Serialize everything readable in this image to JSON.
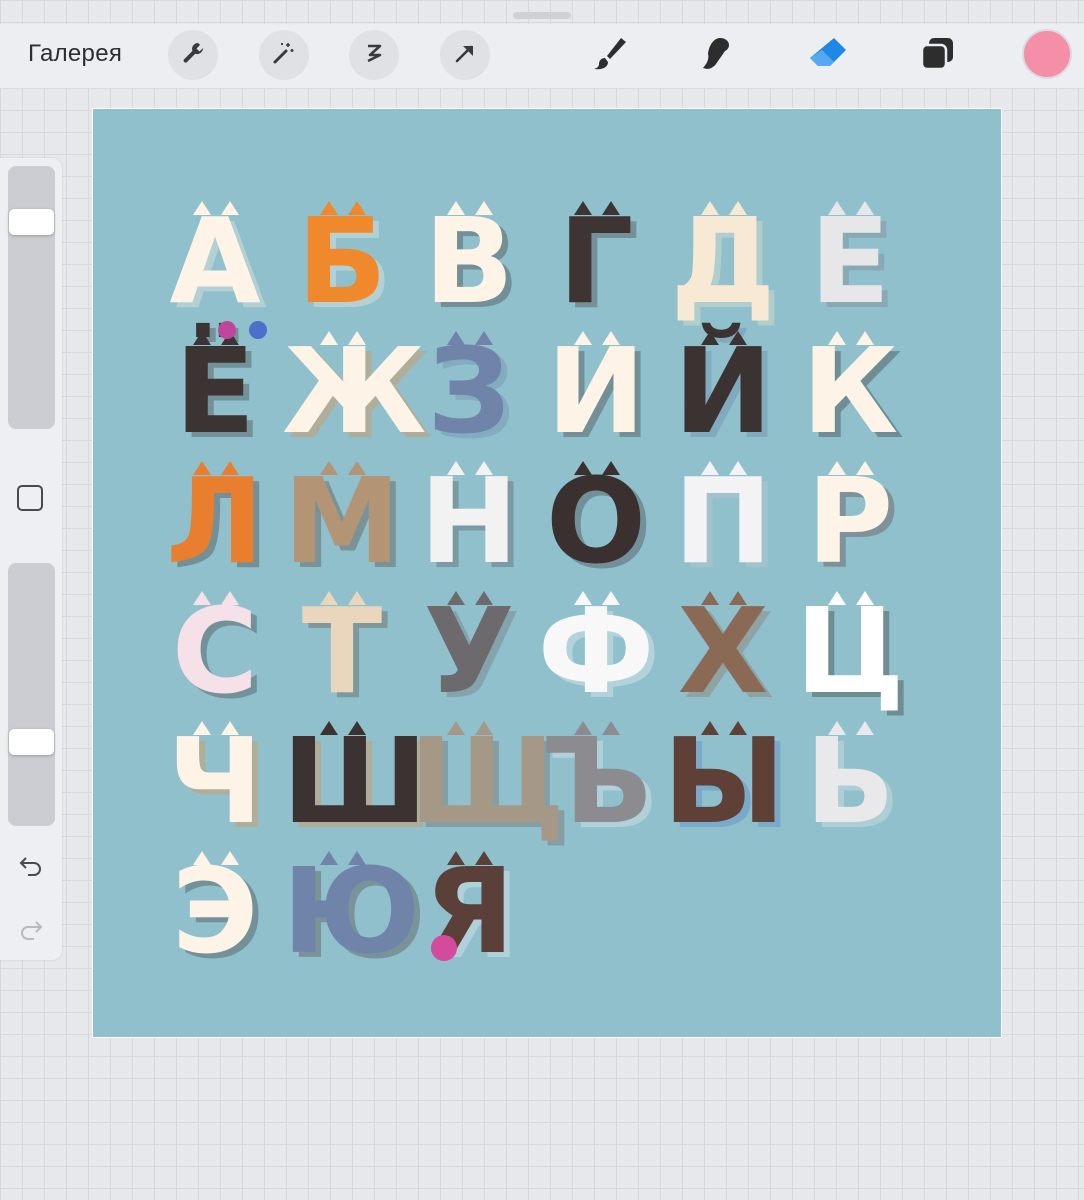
{
  "toolbar": {
    "gallery_label": "Галерея",
    "actions": [
      "wrench-icon",
      "magic-wand-icon",
      "selection-icon",
      "transform-arrow-icon"
    ],
    "tools": [
      "brush-icon",
      "smudge-icon",
      "eraser-icon",
      "layers-icon"
    ],
    "active_tool": "eraser",
    "current_color": "#f48fa7"
  },
  "sidebar": {
    "brush_size_level": 0.82,
    "opacity_level": 0.3,
    "controls": [
      "modify-button",
      "undo-icon",
      "redo-icon"
    ]
  },
  "canvas": {
    "background": "#8fc0cc",
    "letters": [
      {
        "char": "А",
        "colors": [
          "#fdf3e6",
          "#fdf3e6"
        ]
      },
      {
        "char": "Б",
        "colors": [
          "#f0892b",
          "#fdf3e6"
        ]
      },
      {
        "char": "В",
        "colors": [
          "#fdf3e6",
          "#3b2f2f"
        ]
      },
      {
        "char": "Г",
        "colors": [
          "#3e3434",
          "#3e3434"
        ]
      },
      {
        "char": "Д",
        "colors": [
          "#f7e9d4",
          "#f7e9d4"
        ]
      },
      {
        "char": "Е",
        "colors": [
          "#e7e7ea",
          "#7f7f85"
        ]
      },
      {
        "char": "Ё",
        "colors": [
          "#3c3333",
          "#3c3333"
        ]
      },
      {
        "char": "Ж",
        "colors": [
          "#fdf3e6",
          "#ec8a3a"
        ]
      },
      {
        "char": "З",
        "colors": [
          "#6f84a8",
          "#6f84a8"
        ]
      },
      {
        "char": "И",
        "colors": [
          "#fdf3e6",
          "#3b2f2f"
        ]
      },
      {
        "char": "Й",
        "colors": [
          "#3b3232",
          "#6a7fa2"
        ]
      },
      {
        "char": "К",
        "colors": [
          "#fdf3e6",
          "#2f2828"
        ]
      },
      {
        "char": "Л",
        "colors": [
          "#e97f2e",
          "#3b2f2f"
        ]
      },
      {
        "char": "М",
        "colors": [
          "#b39475",
          "#4e3b2f"
        ]
      },
      {
        "char": "Н",
        "colors": [
          "#f2f2f2",
          "#505050"
        ]
      },
      {
        "char": "О",
        "colors": [
          "#3a3030",
          "#3a3030"
        ]
      },
      {
        "char": "П",
        "colors": [
          "#f3f3f5",
          "#c8c8cc"
        ]
      },
      {
        "char": "Р",
        "colors": [
          "#fdf3e6",
          "#5b3a34"
        ]
      },
      {
        "char": "С",
        "colors": [
          "#f6e1e8",
          "#3b3232"
        ]
      },
      {
        "char": "Т",
        "colors": [
          "#e9d6bc",
          "#5a4a3c"
        ]
      },
      {
        "char": "У",
        "colors": [
          "#6d6a6e",
          "#6d6a6e"
        ]
      },
      {
        "char": "Ф",
        "colors": [
          "#f8f8f8",
          "#f8f8f8"
        ]
      },
      {
        "char": "Х",
        "colors": [
          "#8a6a55",
          "#8a6a55"
        ]
      },
      {
        "char": "Ц",
        "colors": [
          "#ffffff",
          "#2f2828"
        ]
      },
      {
        "char": "Ч",
        "colors": [
          "#fdf3e6",
          "#ef8a30"
        ]
      },
      {
        "char": "Ш",
        "colors": [
          "#3d3232",
          "#ec8a30"
        ]
      },
      {
        "char": "Щ",
        "colors": [
          "#a59887",
          "#6b5d53"
        ]
      },
      {
        "char": "Ъ",
        "colors": [
          "#8c8c90",
          "#f3f3f3"
        ]
      },
      {
        "char": "Ы",
        "colors": [
          "#5e4037",
          "#4f7ec8"
        ]
      },
      {
        "char": "Ь",
        "colors": [
          "#e9e9ec",
          "#e9e9ec"
        ]
      },
      {
        "char": "Э",
        "colors": [
          "#fdf3e6",
          "#3b3232"
        ]
      },
      {
        "char": "Ю",
        "colors": [
          "#6f84a8",
          "#4b3b34"
        ]
      },
      {
        "char": "Я",
        "colors": [
          "#5a4038",
          "#f3f3f5"
        ]
      }
    ],
    "yarn_balls": [
      "#c0469d",
      "#4d6ecb",
      "#d44a9c"
    ]
  }
}
